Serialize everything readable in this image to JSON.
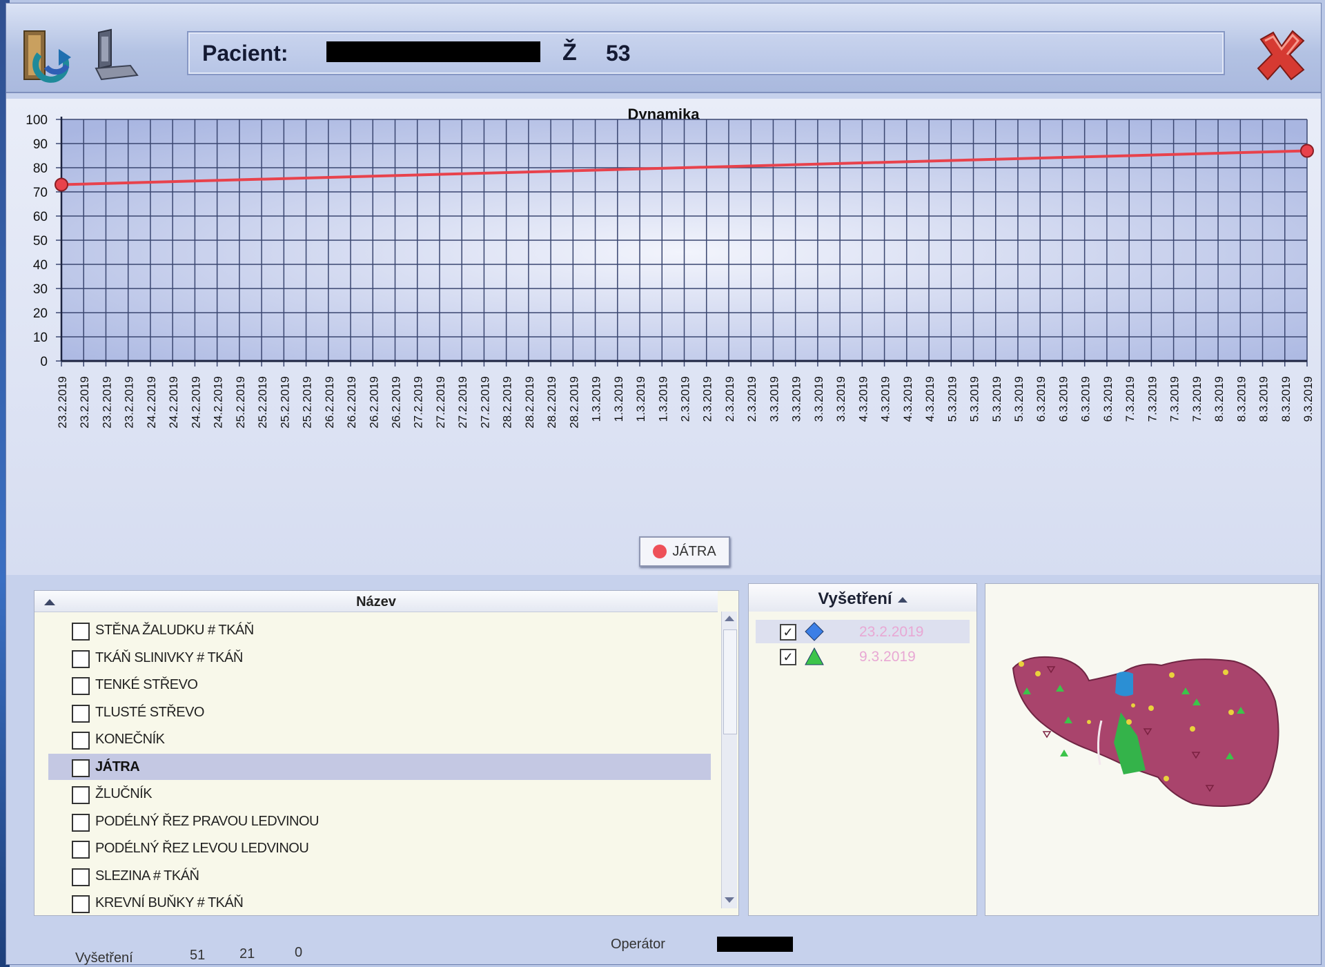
{
  "header": {
    "patient_label": "Pacient:",
    "sex": "Ž",
    "age": "53"
  },
  "toolbar": {
    "refresh_icon": "refresh-icon",
    "monitor_icon": "monitor-icon",
    "close_icon": "close-icon"
  },
  "chart_data": {
    "type": "line",
    "title": "Dynamika",
    "ylim": [
      0,
      100
    ],
    "yticks": [
      0,
      10,
      20,
      30,
      40,
      50,
      60,
      70,
      80,
      90,
      100
    ],
    "grid": true,
    "legend_position": "bottom-center",
    "categories": [
      "23.2.2019",
      "23.2.2019",
      "23.2.2019",
      "23.2.2019",
      "24.2.2019",
      "24.2.2019",
      "24.2.2019",
      "24.2.2019",
      "25.2.2019",
      "25.2.2019",
      "25.2.2019",
      "25.2.2019",
      "26.2.2019",
      "26.2.2019",
      "26.2.2019",
      "26.2.2019",
      "27.2.2019",
      "27.2.2019",
      "27.2.2019",
      "27.2.2019",
      "28.2.2019",
      "28.2.2019",
      "28.2.2019",
      "28.2.2019",
      "1.3.2019",
      "1.3.2019",
      "1.3.2019",
      "1.3.2019",
      "2.3.2019",
      "2.3.2019",
      "2.3.2019",
      "2.3.2019",
      "3.3.2019",
      "3.3.2019",
      "3.3.2019",
      "3.3.2019",
      "4.3.2019",
      "4.3.2019",
      "4.3.2019",
      "4.3.2019",
      "5.3.2019",
      "5.3.2019",
      "5.3.2019",
      "5.3.2019",
      "6.3.2019",
      "6.3.2019",
      "6.3.2019",
      "6.3.2019",
      "7.3.2019",
      "7.3.2019",
      "7.3.2019",
      "7.3.2019",
      "8.3.2019",
      "8.3.2019",
      "8.3.2019",
      "8.3.2019",
      "9.3.2019"
    ],
    "series": [
      {
        "name": "JÁTRA",
        "color": "#e8424c",
        "points": [
          {
            "x": "23.2.2019",
            "y": 73
          },
          {
            "x": "9.3.2019",
            "y": 87
          }
        ]
      }
    ]
  },
  "names": {
    "header": "Název",
    "items": [
      {
        "label": "STĚNA ŽALUDKU # TKÁŇ",
        "checked": false,
        "selected": false
      },
      {
        "label": "TKÁŇ SLINIVKY # TKÁŇ",
        "checked": false,
        "selected": false
      },
      {
        "label": "TENKÉ STŘEVO",
        "checked": false,
        "selected": false
      },
      {
        "label": "TLUSTÉ STŘEVO",
        "checked": false,
        "selected": false
      },
      {
        "label": "KONEČNÍK",
        "checked": false,
        "selected": false
      },
      {
        "label": "JÁTRA",
        "checked": false,
        "selected": true
      },
      {
        "label": "ŽLUČNÍK",
        "checked": false,
        "selected": false
      },
      {
        "label": "PODÉLNÝ ŘEZ PRAVOU LEDVINOU",
        "checked": false,
        "selected": false
      },
      {
        "label": "PODÉLNÝ ŘEZ LEVOU LEDVINOU",
        "checked": false,
        "selected": false
      },
      {
        "label": "SLEZINA # TKÁŇ",
        "checked": false,
        "selected": false
      },
      {
        "label": "KREVNÍ BUŇKY # TKÁŇ",
        "checked": false,
        "selected": false
      }
    ]
  },
  "exams": {
    "header": "Vyšetření",
    "items": [
      {
        "date": "23.2.2019",
        "marker": "diamond",
        "marker_color": "#3c7fe6",
        "checked": true
      },
      {
        "date": "9.3.2019",
        "marker": "triangle",
        "marker_color": "#3cc44a",
        "checked": true
      }
    ]
  },
  "status": {
    "label": "Vyšetření",
    "v1": "51",
    "v2": "21",
    "v3": "0",
    "operator_label": "Operátor"
  }
}
